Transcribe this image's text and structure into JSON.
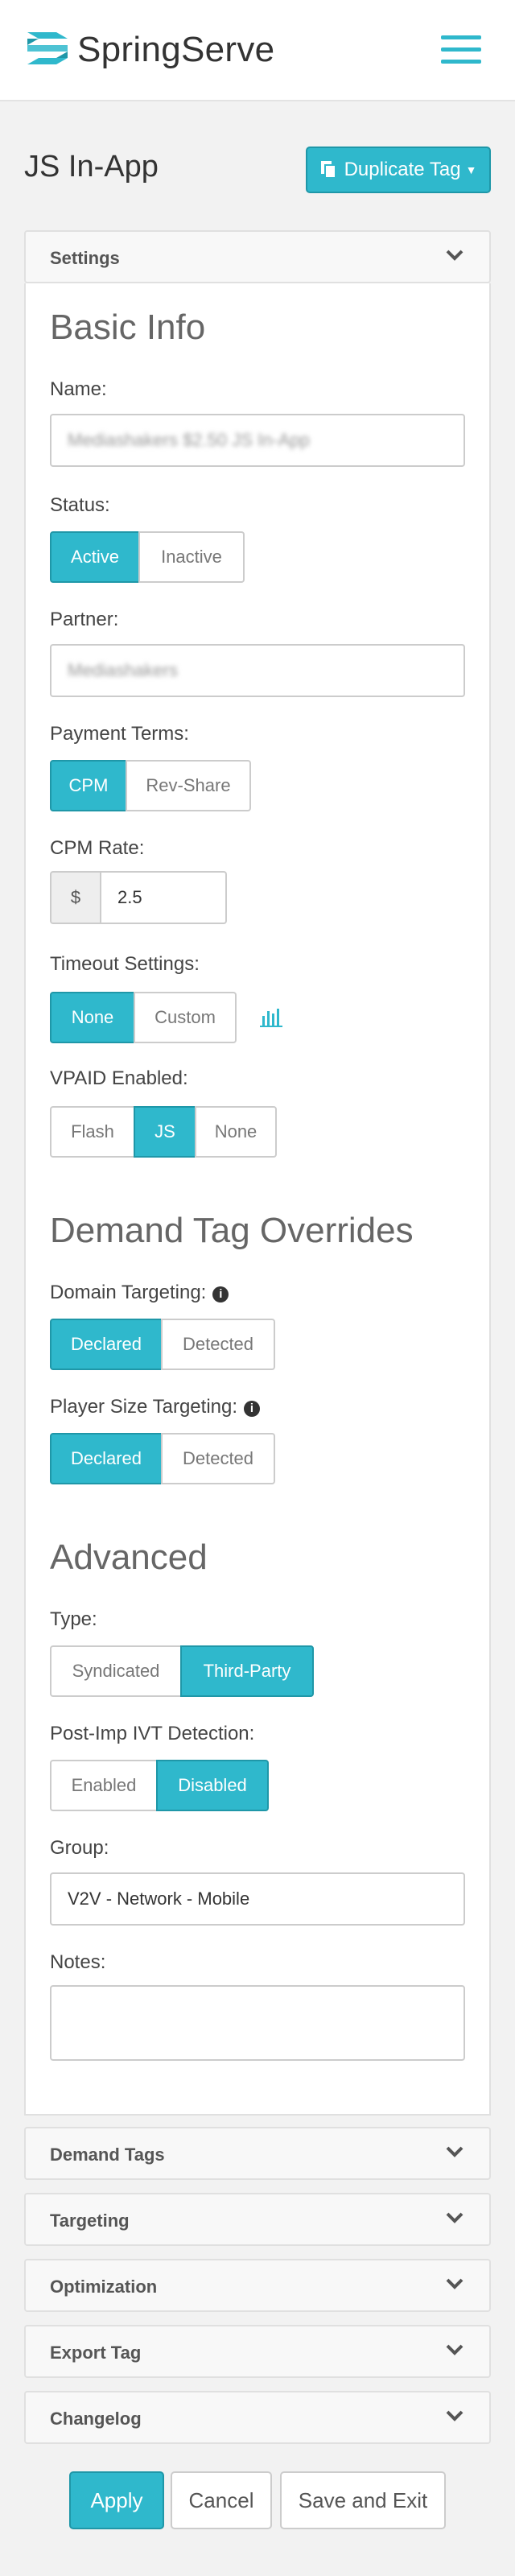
{
  "app": {
    "brand": "SpringServe",
    "accent": "#2fb8cc"
  },
  "page": {
    "title": "JS In-App",
    "duplicate_label": "Duplicate Tag"
  },
  "settings_panel": {
    "label": "Settings"
  },
  "basic_info": {
    "title": "Basic Info",
    "name_label": "Name:",
    "name_value": "Mediashakers $2.50 JS In-App",
    "status_label": "Status:",
    "status_options": [
      "Active",
      "Inactive"
    ],
    "status_selected": "Active",
    "partner_label": "Partner:",
    "partner_value": "Mediashakers",
    "payment_label": "Payment Terms:",
    "payment_options": [
      "CPM",
      "Rev-Share"
    ],
    "payment_selected": "CPM",
    "cpm_label": "CPM Rate:",
    "cpm_prefix": "$",
    "cpm_value": "2.5",
    "timeout_label": "Timeout Settings:",
    "timeout_options": [
      "None",
      "Custom"
    ],
    "timeout_selected": "None",
    "timeout_icon": "bar-chart-icon",
    "vpaid_label": "VPAID Enabled:",
    "vpaid_options": [
      "Flash",
      "JS",
      "None"
    ],
    "vpaid_selected": "JS"
  },
  "overrides": {
    "title": "Demand Tag Overrides",
    "domain_label": "Domain Targeting:",
    "domain_options": [
      "Declared",
      "Detected"
    ],
    "domain_selected": "Declared",
    "player_label": "Player Size Targeting:",
    "player_options": [
      "Declared",
      "Detected"
    ],
    "player_selected": "Declared",
    "info_icon": "info-icon"
  },
  "advanced": {
    "title": "Advanced",
    "type_label": "Type:",
    "type_options": [
      "Syndicated",
      "Third-Party"
    ],
    "type_selected": "Third-Party",
    "ivt_label": "Post-Imp IVT Detection:",
    "ivt_options": [
      "Enabled",
      "Disabled"
    ],
    "ivt_selected": "Disabled",
    "group_label": "Group:",
    "group_value": "V2V - Network - Mobile",
    "notes_label": "Notes:",
    "notes_value": ""
  },
  "collapsed_panels": [
    "Demand Tags",
    "Targeting",
    "Optimization",
    "Export Tag",
    "Changelog"
  ],
  "actions": {
    "apply": "Apply",
    "cancel": "Cancel",
    "save_exit": "Save and Exit"
  }
}
